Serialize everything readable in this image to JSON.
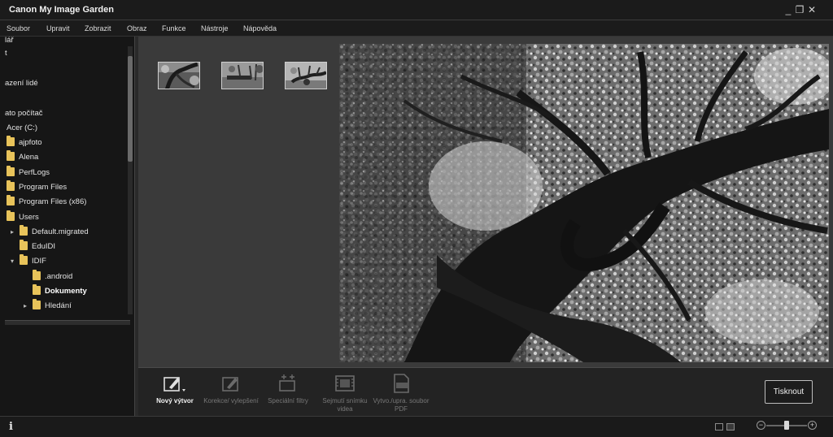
{
  "app": {
    "title": "Canon My Image Garden"
  },
  "window_controls": {
    "minimize": "_",
    "restore": "❐",
    "close": "✕"
  },
  "menu": [
    "Soubor",
    "Upravit",
    "Zobrazit",
    "Obraz",
    "Funkce",
    "Nástroje",
    "Nápověda"
  ],
  "sidebar": {
    "top_items": [
      "lář",
      "t",
      "azení lidé",
      "ato počítač",
      "Acer (C:)"
    ],
    "folders": [
      {
        "label": "ajpfoto",
        "level": 0,
        "arrow": "",
        "bold": false
      },
      {
        "label": "Alena",
        "level": 0,
        "arrow": "",
        "bold": false
      },
      {
        "label": "PerfLogs",
        "level": 0,
        "arrow": "",
        "bold": false
      },
      {
        "label": "Program Files",
        "level": 0,
        "arrow": "",
        "bold": false
      },
      {
        "label": "Program Files (x86)",
        "level": 0,
        "arrow": "",
        "bold": false
      },
      {
        "label": "Users",
        "level": 0,
        "arrow": "",
        "bold": false
      },
      {
        "label": "Default.migrated",
        "level": 1,
        "arrow": "▸",
        "bold": false
      },
      {
        "label": "EduIDI",
        "level": 1,
        "arrow": "",
        "bold": false
      },
      {
        "label": "IDIF",
        "level": 1,
        "arrow": "▾",
        "bold": false
      },
      {
        "label": ".android",
        "level": 2,
        "arrow": "",
        "bold": false
      },
      {
        "label": "Dokumenty",
        "level": 2,
        "arrow": "",
        "bold": true
      },
      {
        "label": "Hledání",
        "level": 2,
        "arrow": "▸",
        "bold": false
      }
    ]
  },
  "thumbnails": [
    "tree-photo-1",
    "tree-photo-2",
    "tree-photo-3"
  ],
  "toolbar": {
    "tools": [
      {
        "label": "Nový výtvor",
        "icon": "new-creation-icon",
        "active": true
      },
      {
        "label": "Korekce/ vylepšení",
        "icon": "correct-enhance-icon",
        "active": false
      },
      {
        "label": "Speciální filtry",
        "icon": "special-filters-icon",
        "active": false
      },
      {
        "label": "Sejmutí snímku videa",
        "icon": "video-capture-icon",
        "active": false
      },
      {
        "label": "Vytvo./upra. soubor PDF",
        "icon": "pdf-icon",
        "active": false
      }
    ],
    "print_label": "Tisknout"
  },
  "statusbar": {
    "info_icon": "i",
    "zoom_minus": "−",
    "zoom_plus": "+",
    "zoom_level": 0.5
  }
}
